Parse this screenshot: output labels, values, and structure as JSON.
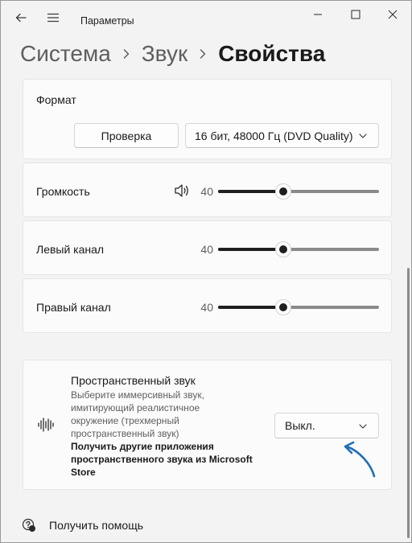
{
  "app": {
    "title": "Параметры"
  },
  "breadcrumb": {
    "items": [
      "Система",
      "Звук"
    ],
    "current": "Свойства"
  },
  "format": {
    "label": "Формат",
    "test_button": "Проверка",
    "selected_format": "16 бит, 48000 Гц (DVD Quality)"
  },
  "volume": {
    "label": "Громкость",
    "value": "40",
    "level_percent": 40
  },
  "left_channel": {
    "label": "Левый канал",
    "value": "40",
    "level_percent": 40
  },
  "right_channel": {
    "label": "Правый канал",
    "value": "40",
    "level_percent": 40
  },
  "spatial": {
    "title": "Пространственный звук",
    "description": "Выберите иммерсивный звук, имитирующий реалистичное окружение (трехмерный пространственный звук)",
    "link": "Получить другие приложения пространственного звука из Microsoft Store",
    "selected": "Выкл."
  },
  "help": {
    "label": "Получить помощь"
  },
  "colors": {
    "accent": "#1f6eb5",
    "slider_fill": "#1f1f1f",
    "background": "#f3f3f3"
  }
}
